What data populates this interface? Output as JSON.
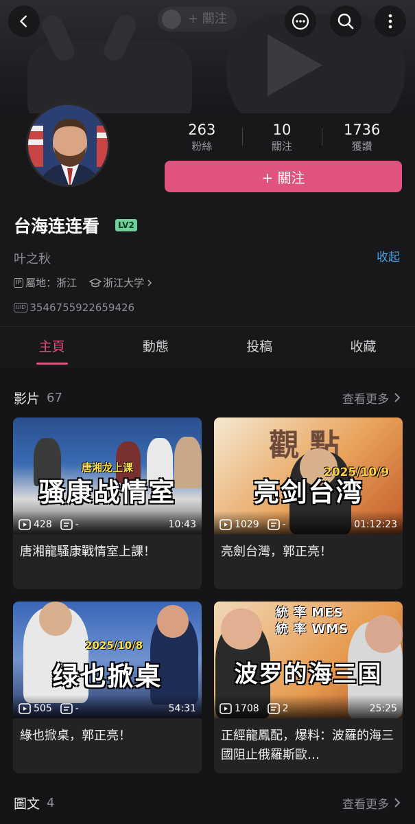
{
  "banner": {
    "ghost_follow": "+ 關注"
  },
  "profile": {
    "stats": [
      {
        "num": "263",
        "label": "粉絲"
      },
      {
        "num": "10",
        "label": "關注"
      },
      {
        "num": "1736",
        "label": "獲讚"
      }
    ],
    "follow_label": "+ 關注",
    "nickname": "台海连连看",
    "level": "LV2",
    "bio": "叶之秋",
    "collapse_label": "收起",
    "ip_chip": "IP",
    "ip_location": "屬地：浙江",
    "school": "浙江大学",
    "uid_chip": "UID",
    "uid": "3546755922659426",
    "colors": {
      "accent": "#e0537f",
      "link": "#4aa3e8",
      "level_badge": "#6fcf97"
    }
  },
  "tabs": [
    "主頁",
    "動態",
    "投稿",
    "收藏"
  ],
  "videos_section": {
    "title": "影片",
    "count": "67",
    "more": "查看更多"
  },
  "videos": [
    {
      "caption": "骚康战情室",
      "tag": "唐湘龙上课",
      "views": "428",
      "comments": "-",
      "duration": "10:43",
      "title": "唐湘龍騷康戰情室上課！"
    },
    {
      "caption": "亮剑台湾",
      "tag": "2025/10/9",
      "views": "1029",
      "comments": "-",
      "duration": "01:12:23",
      "title": "亮劍台灣，郭正亮！"
    },
    {
      "caption": "绿也掀桌",
      "tag": "2025/10/8",
      "views": "505",
      "comments": "-",
      "duration": "54:31",
      "title": "綠也掀桌，郭正亮！"
    },
    {
      "caption": "波罗的海三国",
      "tag": "統 率 MES",
      "tag2": "統 率 WMS",
      "views": "1708",
      "comments": "2",
      "duration": "25:25",
      "title": "正經龍鳳配，爆料：波羅的海三國阻止俄羅斯歐…"
    }
  ],
  "posts_section": {
    "title": "圖文",
    "count": "4",
    "more": "查看更多"
  }
}
